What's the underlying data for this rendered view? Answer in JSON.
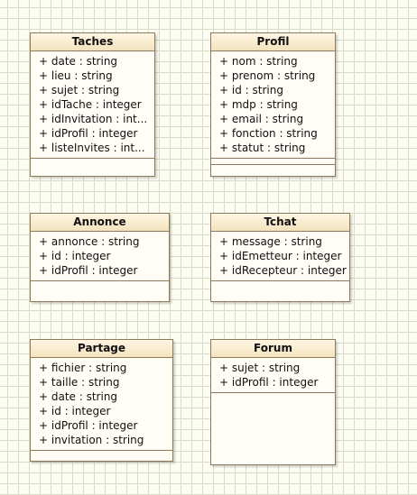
{
  "classes": {
    "taches": {
      "name": "Taches",
      "attributes": [
        "+ date : string",
        "+ lieu : string",
        "+ sujet : string",
        "+ idTache : integer",
        "+ idInvitation : int...",
        "+ idProfil : integer",
        "+ listeInvites : int..."
      ]
    },
    "profil": {
      "name": "Profil",
      "attributes": [
        "+ nom : string",
        "+ prenom : string",
        "+ id : string",
        "+ mdp : string",
        "+ email : string",
        "+ fonction : string",
        "+ statut : string"
      ]
    },
    "annonce": {
      "name": "Annonce",
      "attributes": [
        "+ annonce : string",
        "+ id : integer",
        "+ idProfil : integer"
      ]
    },
    "tchat": {
      "name": "Tchat",
      "attributes": [
        "+ message : string",
        "+ idEmetteur : integer",
        "+ idRecepteur : integer"
      ]
    },
    "partage": {
      "name": "Partage",
      "attributes": [
        "+ fichier : string",
        "+ taille : string",
        "+ date : string",
        "+ id : integer",
        "+ idProfil : integer",
        "+ invitation : string"
      ]
    },
    "forum": {
      "name": "Forum",
      "attributes": [
        "+ sujet : string",
        "+ idProfil : integer"
      ]
    }
  }
}
